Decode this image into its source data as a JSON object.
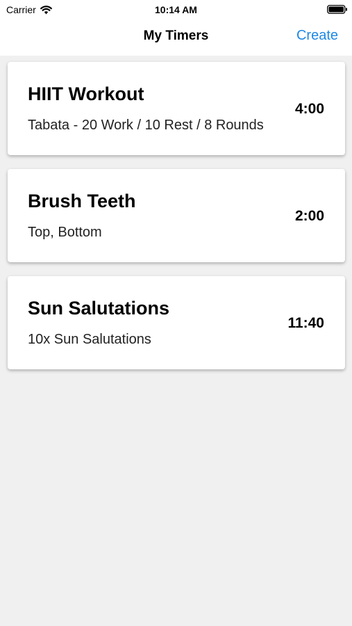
{
  "status_bar": {
    "carrier": "Carrier",
    "time": "10:14 AM",
    "wifi_icon": "wifi-icon",
    "battery_icon": "battery-icon"
  },
  "nav": {
    "title": "My Timers",
    "create_label": "Create",
    "accent_color": "#1e88e5"
  },
  "timers": [
    {
      "title": "HIIT Workout",
      "subtitle": "Tabata - 20 Work / 10 Rest / 8 Rounds",
      "duration": "4:00"
    },
    {
      "title": "Brush Teeth",
      "subtitle": "Top, Bottom",
      "duration": "2:00"
    },
    {
      "title": "Sun Salutations",
      "subtitle": "10x Sun Salutations",
      "duration": "11:40"
    }
  ]
}
